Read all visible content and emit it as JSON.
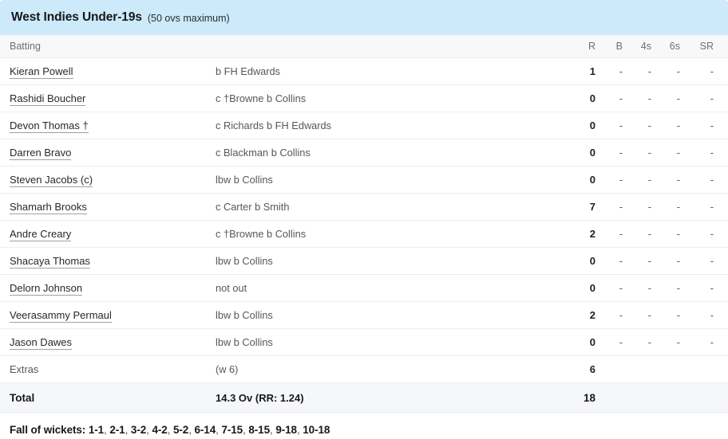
{
  "innings": {
    "team": "West Indies Under-19s",
    "overs_note": "(50 ovs maximum)"
  },
  "columns": {
    "batting": "Batting",
    "dismissal": "",
    "runs": "R",
    "balls": "B",
    "fours": "4s",
    "sixes": "6s",
    "strike_rate": "SR"
  },
  "batsmen": [
    {
      "name": "Kieran Powell",
      "dismissal": "b FH Edwards",
      "r": "1",
      "b": "-",
      "fours": "-",
      "sixes": "-",
      "sr": "-"
    },
    {
      "name": "Rashidi Boucher",
      "dismissal": "c †Browne b Collins",
      "r": "0",
      "b": "-",
      "fours": "-",
      "sixes": "-",
      "sr": "-"
    },
    {
      "name": "Devon Thomas †",
      "dismissal": "c Richards b FH Edwards",
      "r": "0",
      "b": "-",
      "fours": "-",
      "sixes": "-",
      "sr": "-"
    },
    {
      "name": "Darren Bravo",
      "dismissal": "c Blackman b Collins",
      "r": "0",
      "b": "-",
      "fours": "-",
      "sixes": "-",
      "sr": "-"
    },
    {
      "name": "Steven Jacobs (c)",
      "dismissal": "lbw b Collins",
      "r": "0",
      "b": "-",
      "fours": "-",
      "sixes": "-",
      "sr": "-"
    },
    {
      "name": "Shamarh Brooks",
      "dismissal": "c Carter b Smith",
      "r": "7",
      "b": "-",
      "fours": "-",
      "sixes": "-",
      "sr": "-"
    },
    {
      "name": "Andre Creary",
      "dismissal": "c †Browne b Collins",
      "r": "2",
      "b": "-",
      "fours": "-",
      "sixes": "-",
      "sr": "-"
    },
    {
      "name": "Shacaya Thomas",
      "dismissal": "lbw b Collins",
      "r": "0",
      "b": "-",
      "fours": "-",
      "sixes": "-",
      "sr": "-"
    },
    {
      "name": "Delorn Johnson",
      "dismissal": "not out",
      "r": "0",
      "b": "-",
      "fours": "-",
      "sixes": "-",
      "sr": "-"
    },
    {
      "name": "Veerasammy Permaul",
      "dismissal": "lbw b Collins",
      "r": "2",
      "b": "-",
      "fours": "-",
      "sixes": "-",
      "sr": "-"
    },
    {
      "name": "Jason Dawes",
      "dismissal": "lbw b Collins",
      "r": "0",
      "b": "-",
      "fours": "-",
      "sixes": "-",
      "sr": "-"
    }
  ],
  "extras": {
    "label": "Extras",
    "detail": "(w 6)",
    "runs": "6"
  },
  "total": {
    "label": "Total",
    "detail": "14.3 Ov (RR: 1.24)",
    "runs": "18"
  },
  "fall_of_wickets": {
    "label": "Fall of wickets:",
    "entries": [
      "1-1",
      "2-1",
      "3-2",
      "4-2",
      "5-2",
      "6-14",
      "7-15",
      "8-15",
      "9-18",
      "10-18"
    ]
  },
  "colors": {
    "header_bg": "#cceafa",
    "column_header_bg": "#f7f8fa",
    "total_row_bg": "#f5f7fa",
    "row_border": "#eceef0",
    "text_primary": "#26282b",
    "text_muted": "#53585d"
  }
}
